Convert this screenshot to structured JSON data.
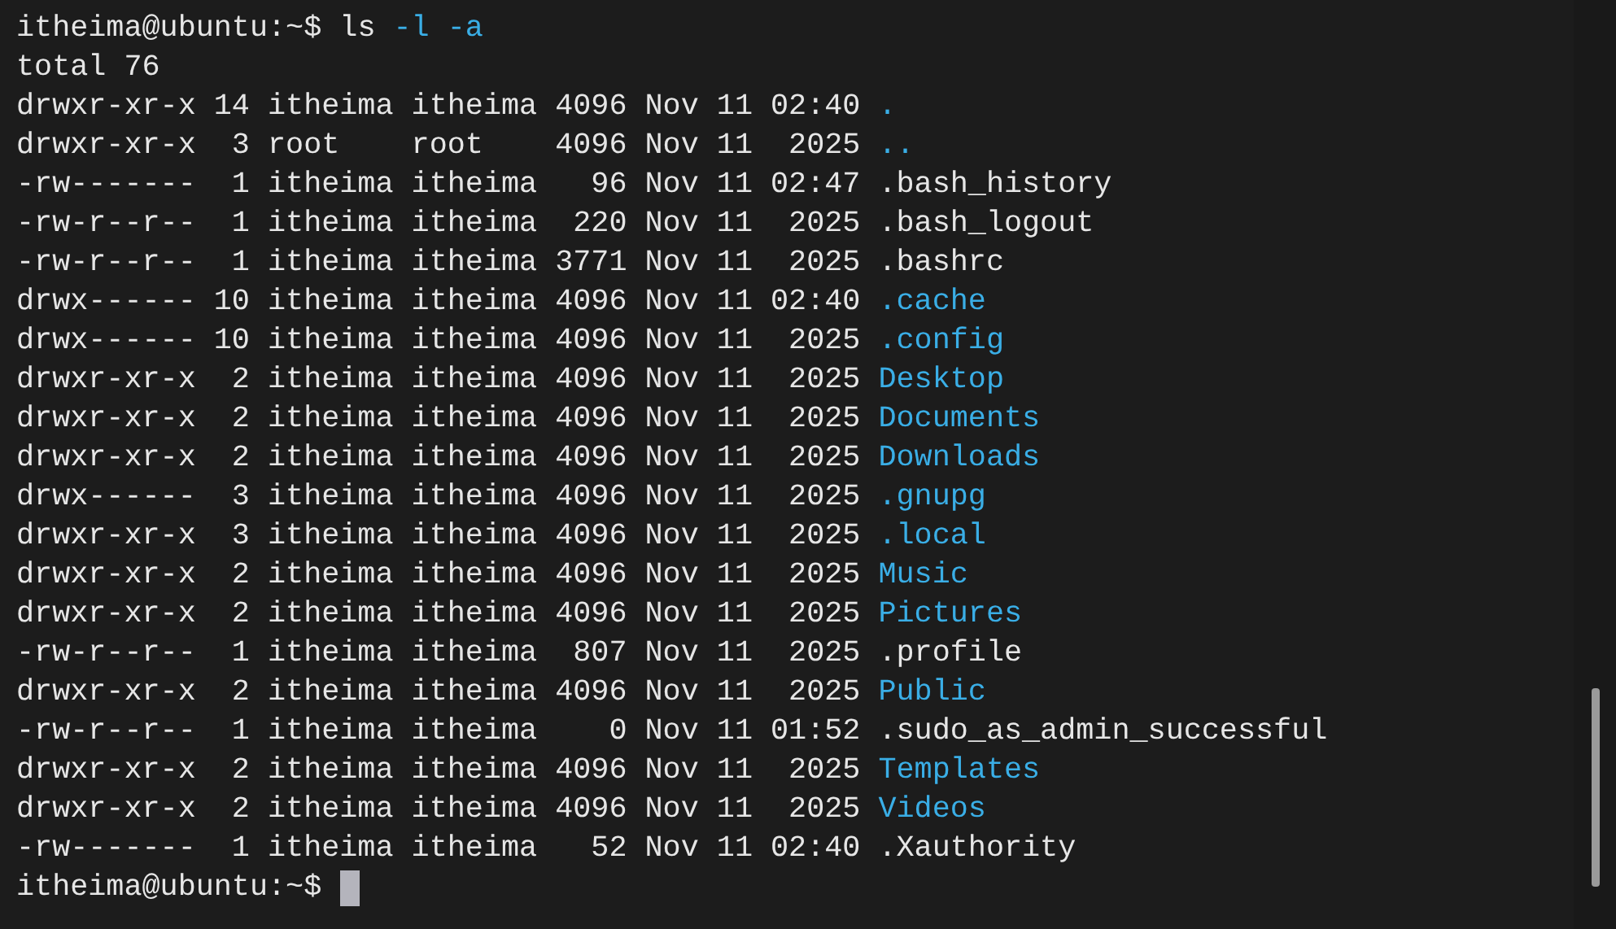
{
  "prompt": {
    "user_host": "itheima@ubuntu:~$",
    "command": "ls",
    "args": "-l -a"
  },
  "total": "total 76",
  "entries": [
    {
      "meta": "drwxr-xr-x 14 itheima itheima 4096 Nov 11 02:40",
      "name": ".",
      "kind": "dir"
    },
    {
      "meta": "drwxr-xr-x  3 root    root    4096 Nov 11  2025",
      "name": "..",
      "kind": "dir"
    },
    {
      "meta": "-rw-------  1 itheima itheima   96 Nov 11 02:47",
      "name": ".bash_history",
      "kind": "file"
    },
    {
      "meta": "-rw-r--r--  1 itheima itheima  220 Nov 11  2025",
      "name": ".bash_logout",
      "kind": "file"
    },
    {
      "meta": "-rw-r--r--  1 itheima itheima 3771 Nov 11  2025",
      "name": ".bashrc",
      "kind": "file"
    },
    {
      "meta": "drwx------ 10 itheima itheima 4096 Nov 11 02:40",
      "name": ".cache",
      "kind": "dir"
    },
    {
      "meta": "drwx------ 10 itheima itheima 4096 Nov 11  2025",
      "name": ".config",
      "kind": "dir"
    },
    {
      "meta": "drwxr-xr-x  2 itheima itheima 4096 Nov 11  2025",
      "name": "Desktop",
      "kind": "dir"
    },
    {
      "meta": "drwxr-xr-x  2 itheima itheima 4096 Nov 11  2025",
      "name": "Documents",
      "kind": "dir"
    },
    {
      "meta": "drwxr-xr-x  2 itheima itheima 4096 Nov 11  2025",
      "name": "Downloads",
      "kind": "dir"
    },
    {
      "meta": "drwx------  3 itheima itheima 4096 Nov 11  2025",
      "name": ".gnupg",
      "kind": "dir"
    },
    {
      "meta": "drwxr-xr-x  3 itheima itheima 4096 Nov 11  2025",
      "name": ".local",
      "kind": "dir"
    },
    {
      "meta": "drwxr-xr-x  2 itheima itheima 4096 Nov 11  2025",
      "name": "Music",
      "kind": "dir"
    },
    {
      "meta": "drwxr-xr-x  2 itheima itheima 4096 Nov 11  2025",
      "name": "Pictures",
      "kind": "dir"
    },
    {
      "meta": "-rw-r--r--  1 itheima itheima  807 Nov 11  2025",
      "name": ".profile",
      "kind": "file"
    },
    {
      "meta": "drwxr-xr-x  2 itheima itheima 4096 Nov 11  2025",
      "name": "Public",
      "kind": "dir"
    },
    {
      "meta": "-rw-r--r--  1 itheima itheima    0 Nov 11 01:52",
      "name": ".sudo_as_admin_successful",
      "kind": "file"
    },
    {
      "meta": "drwxr-xr-x  2 itheima itheima 4096 Nov 11  2025",
      "name": "Templates",
      "kind": "dir"
    },
    {
      "meta": "drwxr-xr-x  2 itheima itheima 4096 Nov 11  2025",
      "name": "Videos",
      "kind": "dir"
    },
    {
      "meta": "-rw-------  1 itheima itheima   52 Nov 11 02:40",
      "name": ".Xauthority",
      "kind": "file"
    }
  ],
  "final_prompt": {
    "user_host": "itheima@ubuntu:~$"
  }
}
